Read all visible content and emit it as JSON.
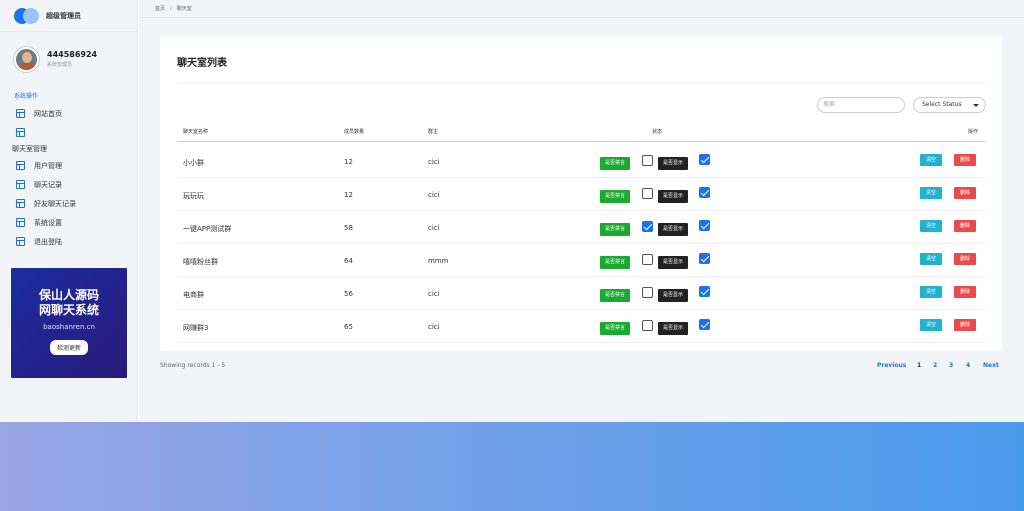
{
  "sidebar": {
    "brand_title": "超级管理员",
    "profile": {
      "name": "444586924",
      "role": "系统管理员"
    },
    "section_system": "系统操作",
    "system_items": [
      {
        "label": "网站首页"
      },
      {
        "label": ""
      }
    ],
    "section_chatroom": "聊天室管理",
    "chatroom_items": [
      {
        "label": "用户管理"
      },
      {
        "label": "聊天记录"
      },
      {
        "label": "好友聊天记录"
      },
      {
        "label": "系统设置"
      },
      {
        "label": "退出登陆"
      }
    ],
    "promo": {
      "line1": "保山人源码",
      "line2": "网聊天系统",
      "url": "baoshanren.cn",
      "button": "检测更新"
    }
  },
  "breadcrumb": {
    "home": "首页",
    "sep": "/",
    "current": "聊天室"
  },
  "card": {
    "title": "聊天室列表",
    "search_placeholder": "搜索",
    "select_value": "Select Status",
    "columns": {
      "name": "聊天室名称",
      "members": "成员数量",
      "owner": "群主",
      "status": "状态",
      "actions": "操作"
    },
    "mute_label": "是否禁言",
    "show_label": "是否显示",
    "clear_label": "清空",
    "delete_label": "删除",
    "rows": [
      {
        "name": "小小群",
        "members": "12",
        "owner": "cici",
        "muted": false,
        "shown": true
      },
      {
        "name": "玩玩玩",
        "members": "12",
        "owner": "cici",
        "muted": false,
        "shown": true
      },
      {
        "name": "一键APP测试群",
        "members": "58",
        "owner": "cici",
        "muted": true,
        "shown": true
      },
      {
        "name": "嘻嘻粉丝群",
        "members": "64",
        "owner": "mmm",
        "muted": false,
        "shown": true
      },
      {
        "name": "电商群",
        "members": "56",
        "owner": "cici",
        "muted": false,
        "shown": true
      },
      {
        "name": "网赚群3",
        "members": "65",
        "owner": "cici",
        "muted": false,
        "shown": true
      }
    ]
  },
  "footer": {
    "showing": "Showing records 1 - 5",
    "previous": "Previous",
    "pages": [
      "1",
      "2",
      "3",
      "4"
    ],
    "next": "Next"
  },
  "colors": {
    "accent": "#1a73e8",
    "mute_badge": "#1aab2e",
    "show_badge": "#222222",
    "clear_btn": "#20b3cf",
    "delete_btn": "#eb4a4a"
  }
}
